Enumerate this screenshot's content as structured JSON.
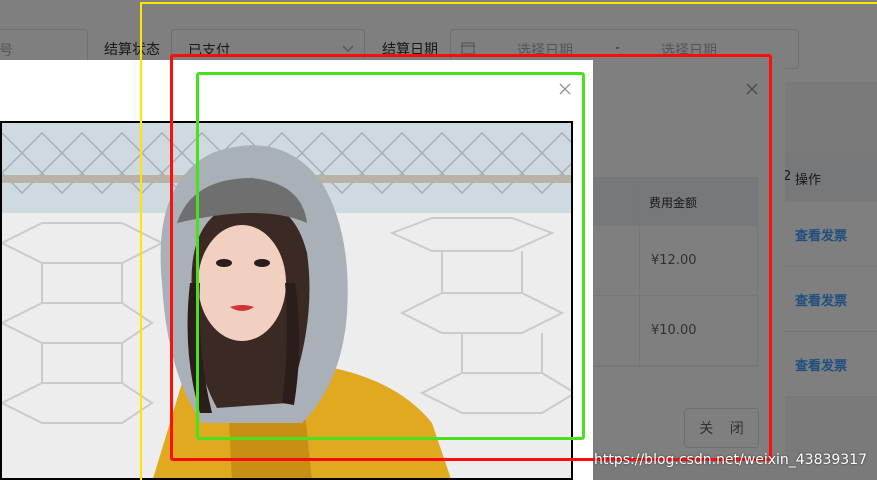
{
  "filters": {
    "partial_placeholder": "号",
    "settlement_status_label": "结算状态",
    "settlement_status_value": "已支付",
    "settlement_date_label": "结算日期",
    "date_start_placeholder": "选择日期",
    "date_separator": "-",
    "date_end_placeholder": "选择日期"
  },
  "main_table": {
    "partial_header": "2",
    "operation_header": "操作",
    "rows": [
      {
        "action": "查看发票"
      },
      {
        "action": "查看发票"
      },
      {
        "action": "查看发票"
      }
    ]
  },
  "invoice_dialog": {
    "close_icon": "close-icon",
    "amount_header": "费用金额",
    "amounts": [
      "¥12.00",
      "¥10.00"
    ],
    "close_button_label": "关 闭"
  },
  "preview_dialog": {
    "close_icon": "close-icon"
  },
  "watermark": "https://blog.csdn.net/weixin_43839317",
  "colors": {
    "link": "#409eff",
    "annotation_yellow": "#ffe600",
    "annotation_red": "#ff0d0d",
    "annotation_green": "#48e01f"
  }
}
